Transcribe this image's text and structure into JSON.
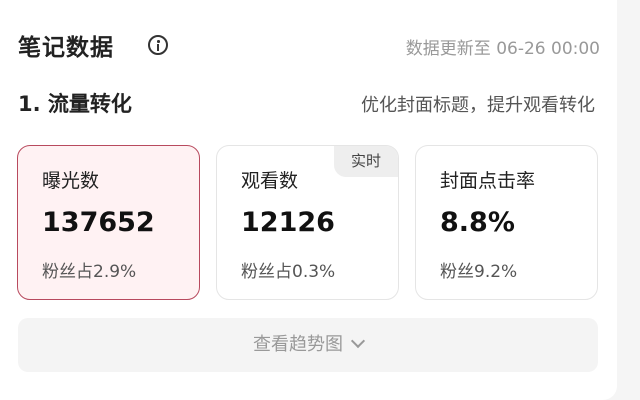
{
  "header": {
    "title": "笔记数据",
    "update_time": "数据更新至 06-26 00:00"
  },
  "section": {
    "title": "1. 流量转化",
    "tip": "优化封面标题，提升观看转化"
  },
  "metrics": [
    {
      "label": "曝光数",
      "value": "137652",
      "sub": "粉丝占2.9%",
      "selected": true
    },
    {
      "label": "观看数",
      "value": "12126",
      "sub": "粉丝占0.3%",
      "tag": "实时"
    },
    {
      "label": "封面点击率",
      "value": "8.8%",
      "sub": "粉丝9.2%"
    }
  ],
  "trend_button": {
    "label": "查看趋势图",
    "icon": "chevron-down-icon"
  },
  "colors": {
    "selected_border": "#b84a5e",
    "selected_bg": "#fff2f3"
  }
}
